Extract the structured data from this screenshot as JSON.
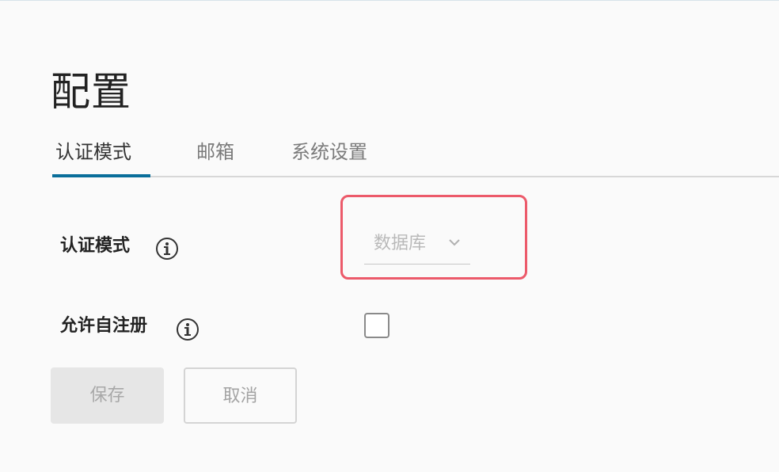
{
  "page": {
    "title": "配置"
  },
  "tabs": [
    {
      "label": "认证模式",
      "active": true
    },
    {
      "label": "邮箱",
      "active": false
    },
    {
      "label": "系统设置",
      "active": false
    }
  ],
  "form": {
    "auth_mode": {
      "label": "认证模式",
      "icon": "info-icon",
      "value": "数据库"
    },
    "self_register": {
      "label": "允许自注册",
      "icon": "info-icon",
      "checked": false
    }
  },
  "actions": {
    "save_label": "保存",
    "cancel_label": "取消"
  },
  "colors": {
    "accent": "#0a6e9a",
    "highlight": "#ec5a6a"
  }
}
